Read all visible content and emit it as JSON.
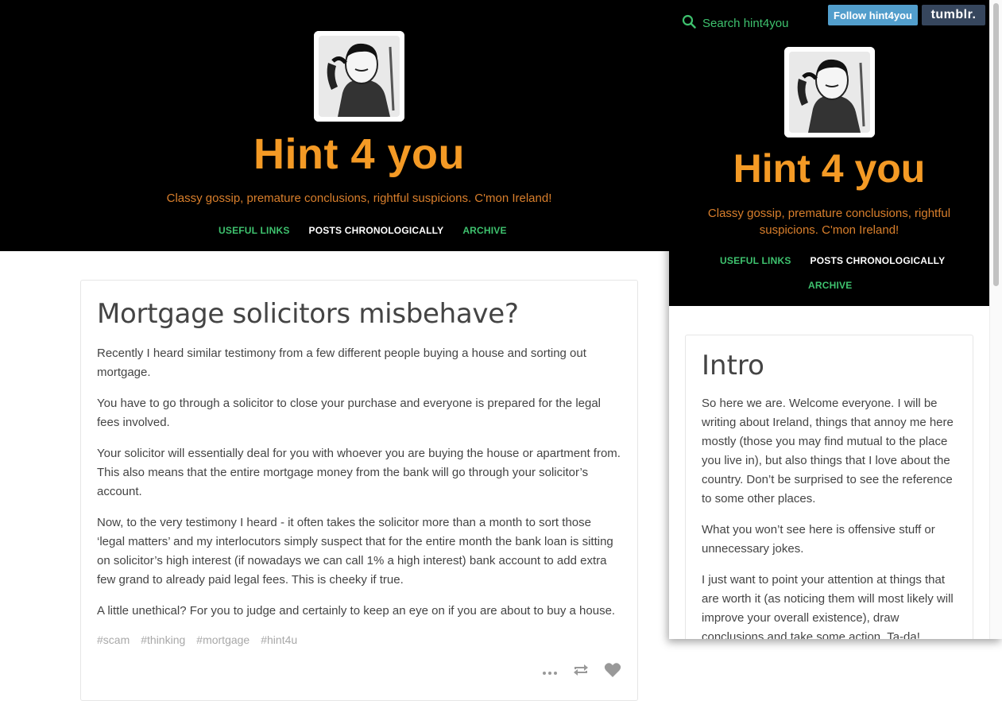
{
  "blog": {
    "title": "Hint 4 you",
    "description": "Classy gossip, premature conclusions, rightful suspicions. C'mon Ireland!",
    "nav": [
      "USEFUL LINKS",
      "POSTS CHRONOLOGICALLY",
      "ARCHIVE"
    ]
  },
  "post": {
    "title": "Mortgage solicitors misbehave?",
    "paragraphs": [
      "Recently I heard similar testimony from a few different people buying a house and sorting out mortgage.",
      "You have to go through a solicitor to close your purchase and everyone is prepared for the legal fees involved.",
      "Your solicitor will essentially deal for you with whoever you are buying the house or apartment from. This also means that the entire mortgage money from the bank will go through your solicitor’s account.",
      "Now, to the very testimony I heard - it often takes the solicitor more than a month to sort those ‘legal matters’ and my interlocutors simply suspect that for the entire month the bank loan is sitting on solicitor’s high interest (if nowadays we can call 1% a high interest) bank account to add extra few grand to already paid legal fees. This is cheeky if true.",
      "A little unethical? For you to judge and certainly to keep an eye on if you are about to buy a house."
    ],
    "tags": [
      "#scam",
      "#thinking",
      "#mortgage",
      "#hint4u"
    ]
  },
  "panel": {
    "search_placeholder": "Search hint4you",
    "follow_label": "Follow hint4you",
    "tumblr_label": "tumblr.",
    "post": {
      "title": "Intro",
      "paragraphs": [
        "So here we are. Welcome everyone. I will be writing about Ireland, things that annoy me here mostly (those you may find mutual to the place you live in), but also things that I love about the country. Don’t be surprised to see the reference to some other places.",
        "What you won’t see here is offensive stuff or unnecessary jokes.",
        "I just want to point your attention at things that are worth it (as noticing them will most likely will improve your overall existence), draw conclusions and take some action. Ta-da!"
      ]
    }
  },
  "colors": {
    "accent_orange": "#f49a25",
    "link_green": "#3ec26e",
    "header_bg": "#000000",
    "tumblr_blue": "#529ecc"
  },
  "icons": [
    "search-icon",
    "more-icon",
    "reblog-icon",
    "heart-icon"
  ]
}
